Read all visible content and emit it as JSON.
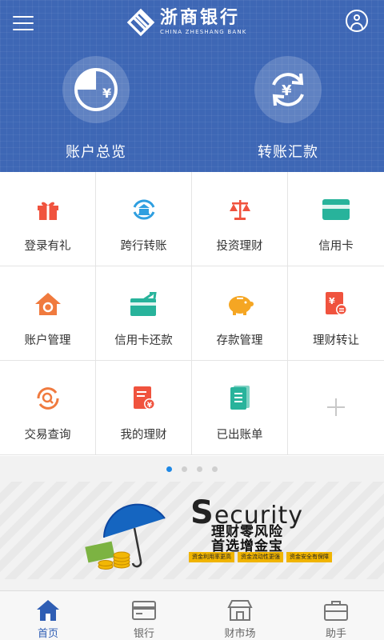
{
  "header": {
    "logo_cn": "浙商银行",
    "logo_en": "CHINA ZHESHANG BANK",
    "actions": [
      {
        "label": "账户总览",
        "icon": "pie-chart-yuan-icon"
      },
      {
        "label": "转账汇款",
        "icon": "transfer-cycle-yuan-icon"
      }
    ]
  },
  "grid": {
    "items": [
      {
        "label": "登录有礼",
        "icon": "gift-icon",
        "color": "#f0533e"
      },
      {
        "label": "跨行转账",
        "icon": "bank-transfer-icon",
        "color": "#2f9fe0"
      },
      {
        "label": "投资理财",
        "icon": "scales-icon",
        "color": "#f0533e"
      },
      {
        "label": "信用卡",
        "icon": "credit-card-icon",
        "color": "#28b39b"
      },
      {
        "label": "账户管理",
        "icon": "home-gear-icon",
        "color": "#f07a3e"
      },
      {
        "label": "信用卡还款",
        "icon": "card-repay-icon",
        "color": "#28b39b"
      },
      {
        "label": "存款管理",
        "icon": "piggy-bank-icon",
        "color": "#f5a623"
      },
      {
        "label": "理财转让",
        "icon": "transfer-doc-icon",
        "color": "#f0533e"
      },
      {
        "label": "交易查询",
        "icon": "search-refresh-icon",
        "color": "#f07a3e"
      },
      {
        "label": "我的理财",
        "icon": "finance-doc-icon",
        "color": "#f0533e"
      },
      {
        "label": "已出账单",
        "icon": "bill-icon",
        "color": "#28b39b"
      },
      {
        "label": "",
        "icon": "add-icon",
        "color": "#c8c8c8"
      }
    ]
  },
  "pager": {
    "count": 4,
    "active": 0
  },
  "banner": {
    "word_first": "S",
    "word_rest": "ecurity",
    "line1": "理财零风险",
    "line2": "首选增金宝",
    "tags": [
      "资金利用率更高",
      "资金流动性更强",
      "资金安全有保障"
    ]
  },
  "tabs": [
    {
      "label": "首页",
      "icon": "home-icon",
      "active": true
    },
    {
      "label": "银行",
      "icon": "bank-card-icon",
      "active": false
    },
    {
      "label": "财市场",
      "icon": "store-icon",
      "active": false
    },
    {
      "label": "助手",
      "icon": "briefcase-icon",
      "active": false
    }
  ],
  "colors": {
    "brand_blue": "#3e67b5",
    "active_tab": "#2f5eb4",
    "pager_active": "#1e88e5"
  }
}
